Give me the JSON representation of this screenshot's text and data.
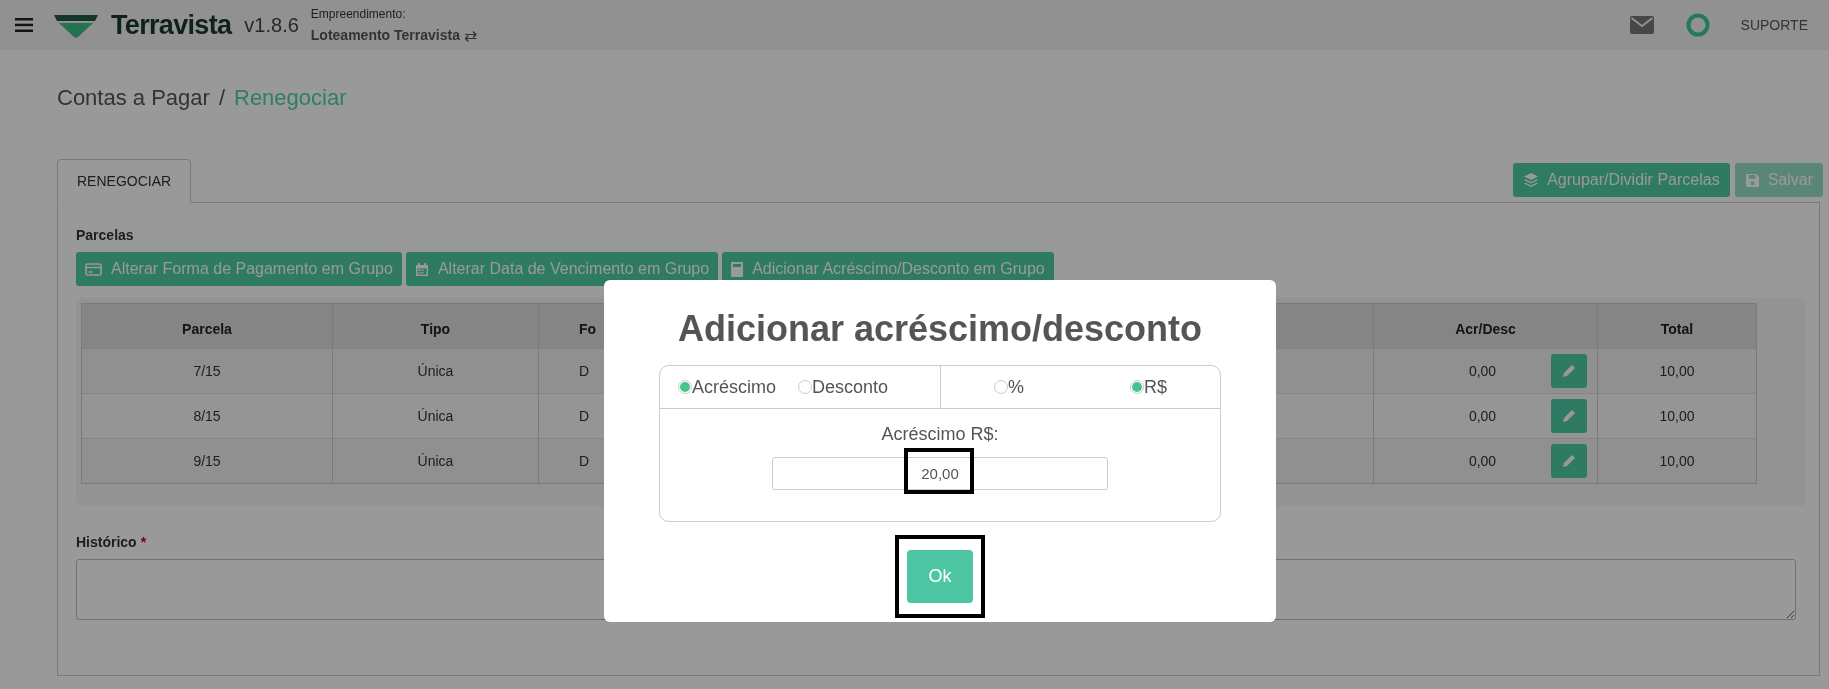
{
  "header": {
    "app_name": "Terravista",
    "version": "v1.8.6",
    "project_label": "Empreendimento:",
    "project_name": "Loteamento Terravista",
    "switch_glyph": "⇄",
    "support": "SUPORTE"
  },
  "breadcrumb": [
    {
      "label": "Contas a Pagar",
      "current": false
    },
    {
      "label": "Renegociar",
      "current": true
    }
  ],
  "breadcrumb_separator": "/",
  "tabs": [
    {
      "label": "RENEGOCIAR",
      "selected": true
    }
  ],
  "toolbar": [
    {
      "label": "Agrupar/Dividir Parcelas",
      "disabled": false
    },
    {
      "label": "Salvar",
      "disabled": true
    }
  ],
  "section_title": "Parcelas",
  "group_buttons": [
    {
      "label": "Alterar Forma de Pagamento em Grupo"
    },
    {
      "label": "Alterar Data de Vencimento em Grupo"
    },
    {
      "label": "Adicionar Acréscimo/Desconto em Grupo"
    }
  ],
  "table": {
    "columns": [
      "Parcela",
      "Tipo",
      "Fo",
      "Acr/Desc",
      "Total"
    ],
    "rows": [
      {
        "cells": [
          "7/15",
          "Única",
          "D",
          "0,00",
          "10,00"
        ]
      },
      {
        "cells": [
          "8/15",
          "Única",
          "D",
          "0,00",
          "10,00"
        ]
      },
      {
        "cells": [
          "9/15",
          "Única",
          "D",
          "0,00",
          "10,00"
        ]
      }
    ]
  },
  "history": {
    "label": "Histórico",
    "required_mark": "*"
  },
  "modal": {
    "title": "Adicionar acréscimo/desconto",
    "type_options": [
      {
        "label": "Acréscimo",
        "selected": true
      },
      {
        "label": "Desconto",
        "selected": false
      }
    ],
    "unit_options": [
      {
        "label": "%",
        "selected": false
      },
      {
        "label": "R$",
        "selected": true
      }
    ],
    "field_label": "Acréscimo R$:",
    "value": "20,00",
    "value_highlighted": true,
    "button": "Ok",
    "button_highlighted": true
  }
}
